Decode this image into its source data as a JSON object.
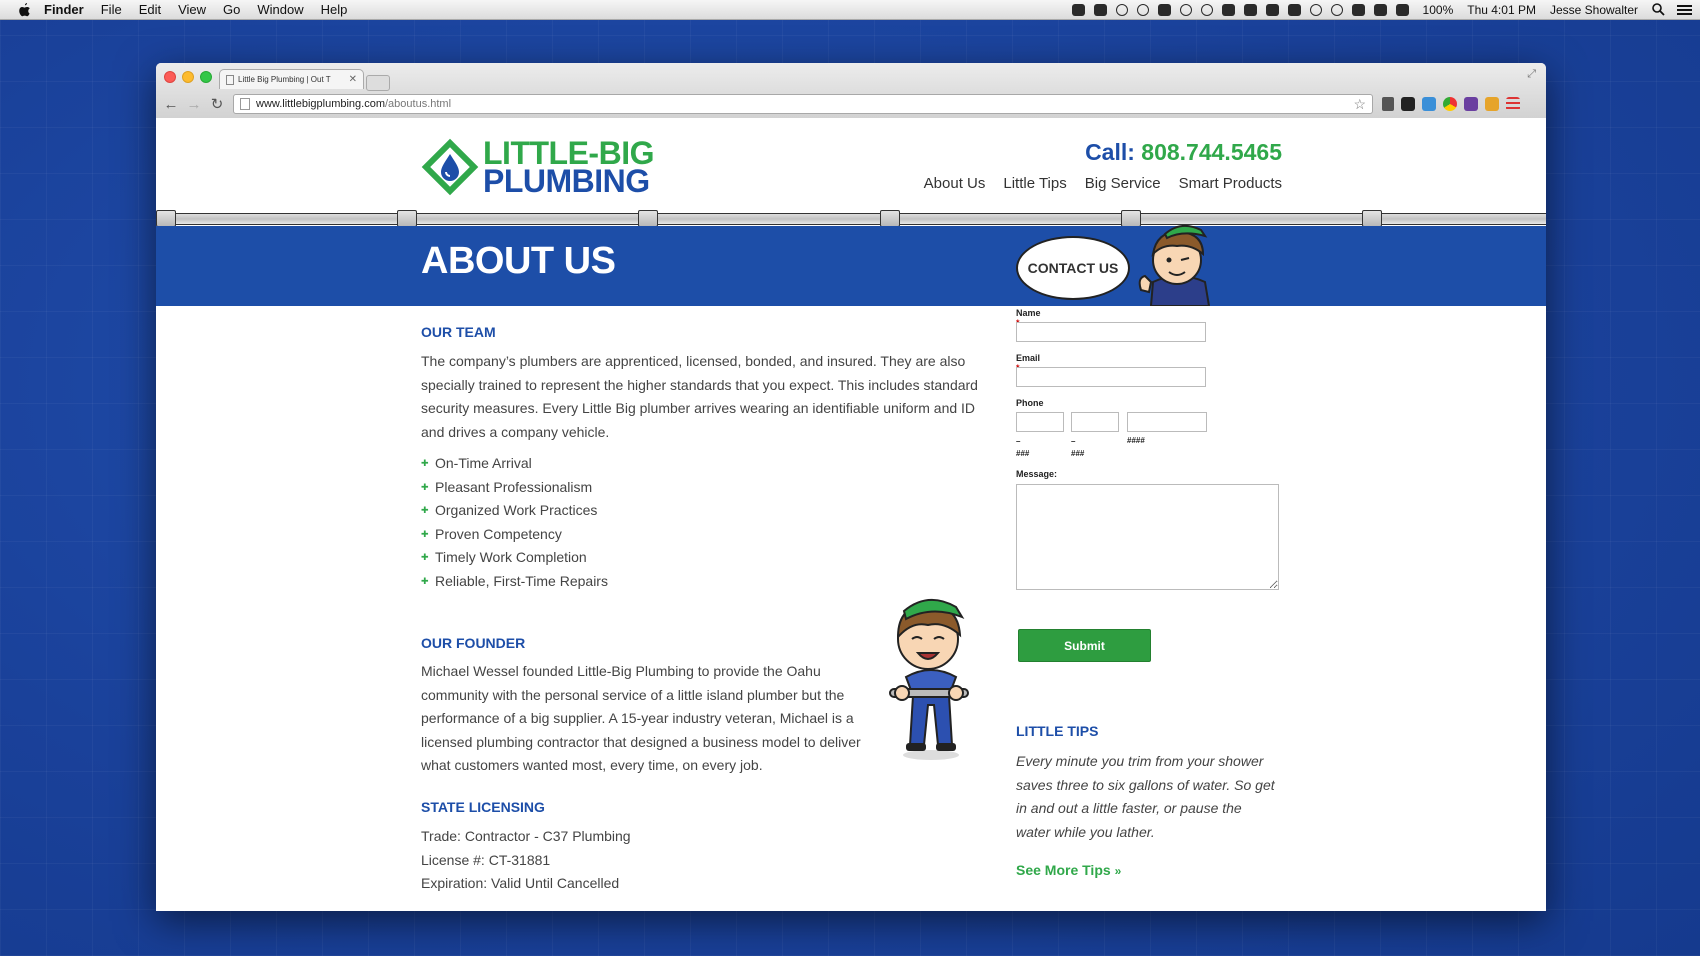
{
  "menubar": {
    "items": [
      "Finder",
      "File",
      "Edit",
      "View",
      "Go",
      "Window",
      "Help"
    ],
    "battery": "100%",
    "clock": "Thu 4:01 PM",
    "user": "Jesse Showalter"
  },
  "browser": {
    "tab_title": "Little Big Plumbing | Out T",
    "url_host": "www.littlebigplumbing.com",
    "url_path": "/aboutus.html"
  },
  "site": {
    "logo_line1": "LITTLE-BIG",
    "logo_line2": "PLUMBING",
    "phone_label": "Call:",
    "phone_number": "808.744.5465",
    "nav": [
      "About Us",
      "Little Tips",
      "Big Service",
      "Smart Products"
    ],
    "page_title": "ABOUT US",
    "contact_bubble": "CONTACT US"
  },
  "team": {
    "heading": "OUR TEAM",
    "body": "The company’s plumbers are apprenticed, licensed, bonded, and insured. They are also specially trained to represent the higher standards that you expect. This includes standard security measures. Every Little Big plumber arrives wearing an identifiable uniform and ID and drives a company vehicle.",
    "bullets": [
      "On-Time Arrival",
      "Pleasant Professionalism",
      "Organized Work Practices",
      "Proven Competency",
      "Timely Work Completion",
      "Reliable, First-Time Repairs"
    ]
  },
  "founder": {
    "heading": "OUR FOUNDER",
    "body": "Michael Wessel founded Little-Big Plumbing to provide the Oahu community with the personal service of a little island plumber but the performance of a big supplier. A 15-year industry veteran, Michael is a licensed plumbing contractor that designed a business model to deliver what customers wanted most, every time, on every job."
  },
  "licensing": {
    "heading": "STATE LICENSING",
    "lines": [
      "Trade: Contractor - C37 Plumbing",
      "License #: CT-31881",
      "Expiration: Valid Until Cancelled"
    ]
  },
  "form": {
    "name_label": "Name",
    "email_label": "Email",
    "phone_label": "Phone",
    "phone_hints": [
      "###",
      "###",
      "####"
    ],
    "message_label": "Message:",
    "required_mark": "*",
    "submit_label": "Submit"
  },
  "tips": {
    "heading": "LITTLE TIPS",
    "body": "Every minute you trim from your shower saves three to six gallons of water. So get in and out a little faster, or pause the water while you lather.",
    "more_link": "See More Tips"
  },
  "colors": {
    "brand_blue": "#1d4ea8",
    "brand_green": "#30a84a",
    "desktop_bg": "#1c46a0"
  }
}
